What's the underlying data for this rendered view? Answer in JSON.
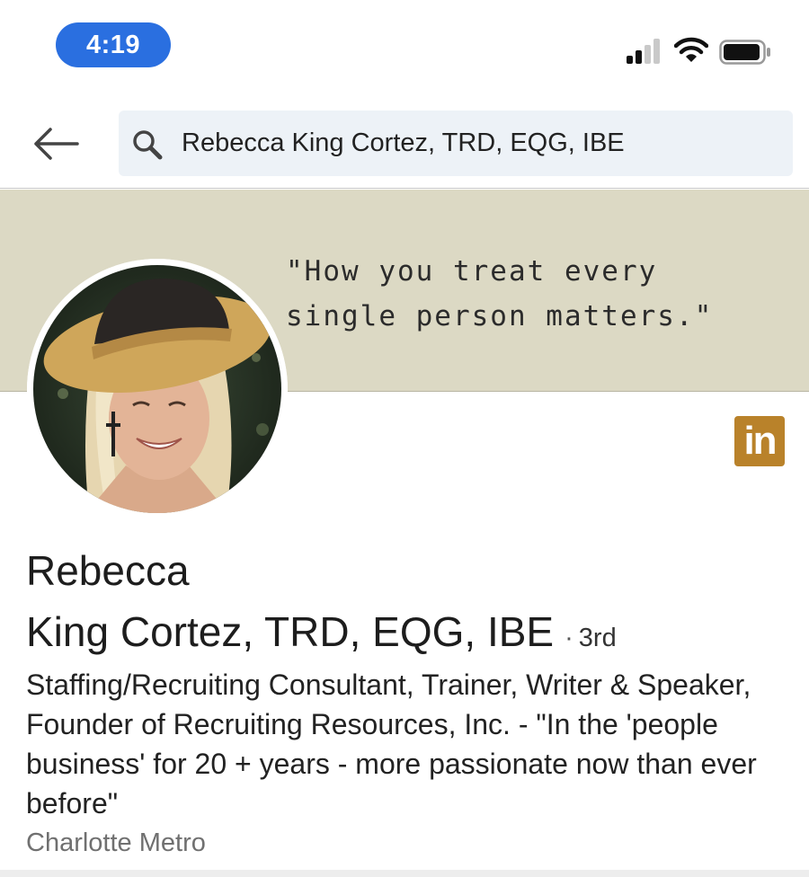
{
  "status_bar": {
    "time": "4:19",
    "icons": [
      "cellular-signal-icon",
      "wifi-icon",
      "battery-icon"
    ]
  },
  "search": {
    "query": "Rebecca King Cortez, TRD, EQG, IBE",
    "icon": "search-icon",
    "back_icon": "back-arrow-icon"
  },
  "cover": {
    "quote_line1": "\"How you treat every",
    "quote_line2": "single person matters.\"",
    "background_color": "#dcd9c4"
  },
  "profile": {
    "name_line1": "Rebecca",
    "name_line2": "King Cortez, TRD, EQG, IBE",
    "separator": "·",
    "degree": "3rd",
    "headline": "Staffing/Recruiting Consultant, Trainer, Writer & Speaker, Founder of Recruiting Resources, Inc. - \"In the 'people business' for 20 + years - more passionate now than ever before\"",
    "location": "Charlotte Metro",
    "badge_text": "in",
    "badge_color": "#b9822a"
  },
  "colors": {
    "accent_blue": "#2a6fe0",
    "search_bg": "#edf2f7"
  }
}
